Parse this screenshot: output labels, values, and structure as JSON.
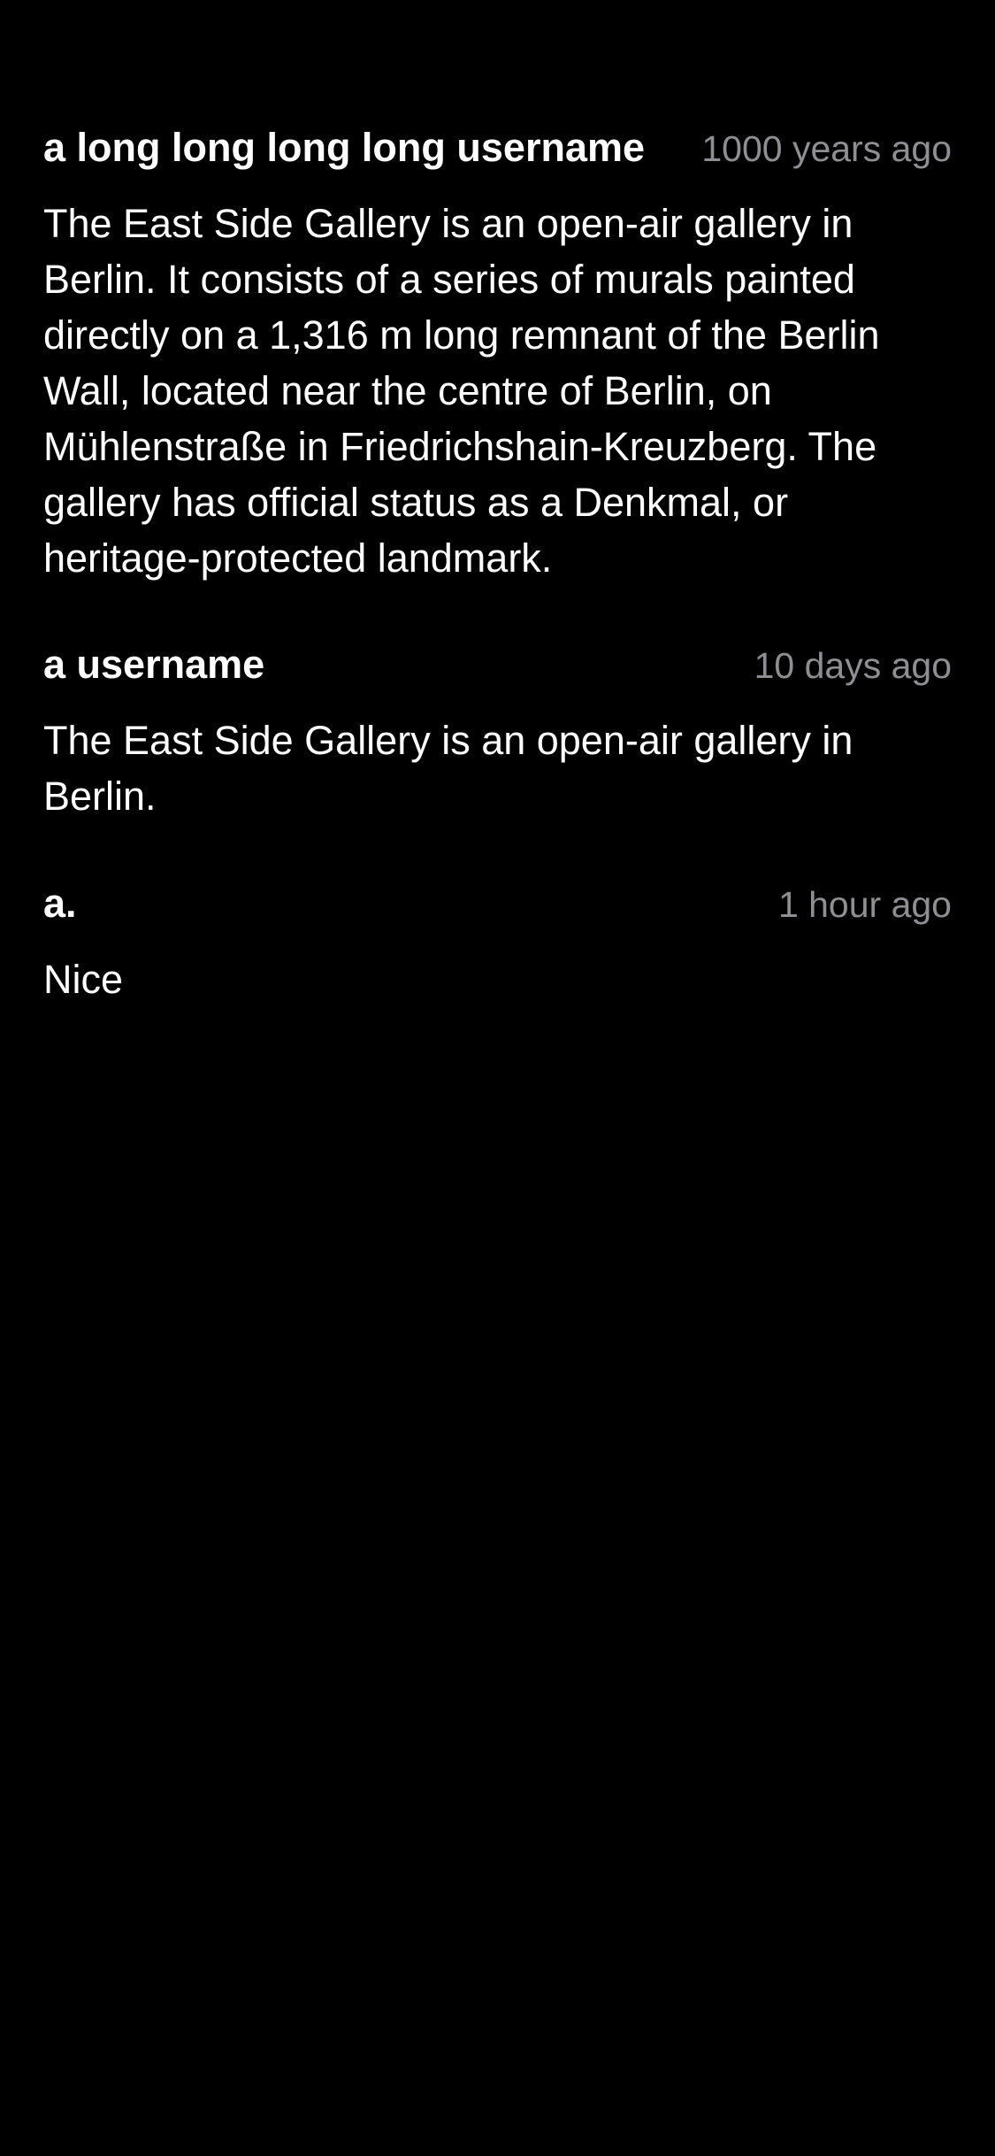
{
  "comments": [
    {
      "username": "a long long long long username",
      "timestamp": "1000 years ago",
      "body": "The East Side Gallery is an open-air gallery in Berlin. It consists of a series of murals painted directly on a 1,316 m long remnant of the Berlin Wall, located near the centre of Berlin, on Mühlenstraße in Friedrichshain-Kreuzberg. The gallery has official status as a Denkmal, or heritage-protected landmark."
    },
    {
      "username": "a username",
      "timestamp": "10 days ago",
      "body": "The East Side Gallery is an open-air gallery in Berlin."
    },
    {
      "username": "a.",
      "timestamp": "1 hour ago",
      "body": "Nice"
    }
  ],
  "colors": {
    "background": "#000000",
    "primary_text": "#ffffff",
    "secondary_text": "#8e8e93"
  }
}
